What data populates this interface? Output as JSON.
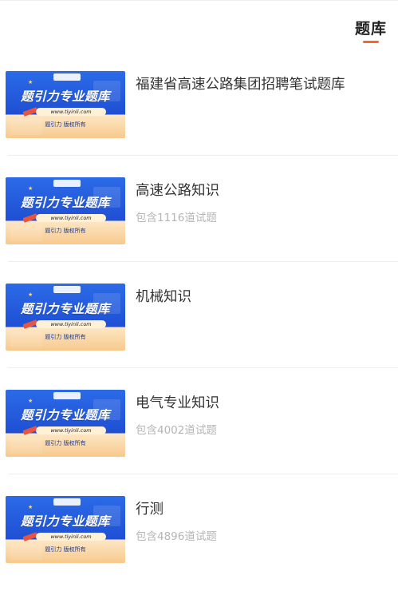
{
  "header": {
    "tab_label": "题库"
  },
  "thumbnail": {
    "title": "题引力专业题库",
    "url": "www.tiyinli.com",
    "footer": "题引力 版权所有"
  },
  "items": [
    {
      "title": "福建省高速公路集团招聘笔试题库",
      "subtitle": ""
    },
    {
      "title": "高速公路知识",
      "subtitle": "包含1116道试题"
    },
    {
      "title": "机械知识",
      "subtitle": ""
    },
    {
      "title": "电气专业知识",
      "subtitle": "包含4002道试题"
    },
    {
      "title": "行测",
      "subtitle": "包含4896道试题"
    }
  ],
  "colors": {
    "accent": "#f06a2b",
    "banner_blue": "#1f4fd3"
  }
}
